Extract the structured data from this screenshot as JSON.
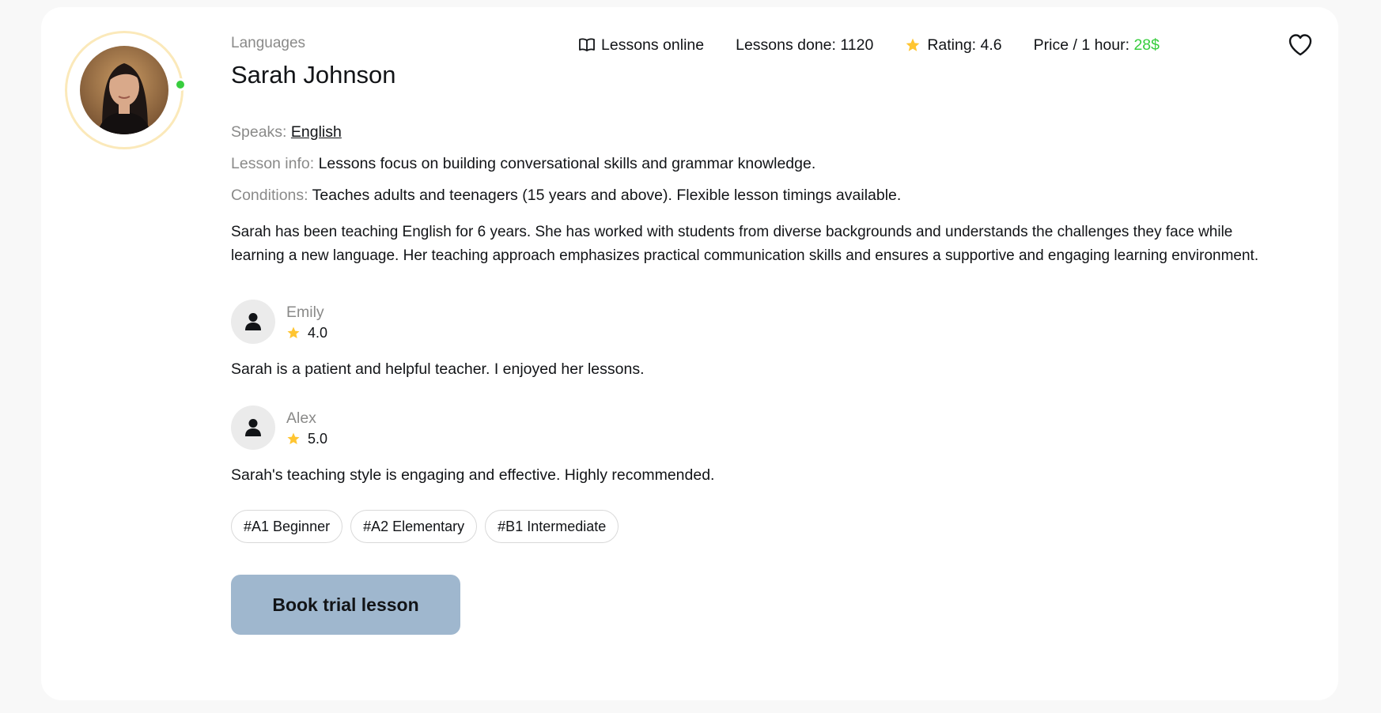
{
  "teacher": {
    "category": "Languages",
    "name": "Sarah Johnson",
    "online": true
  },
  "stats": {
    "lessons_online": "Lessons online",
    "lessons_done_label": "Lessons done: ",
    "lessons_done_value": "1120",
    "rating_label": "Rating: ",
    "rating_value": "4.6",
    "price_label": "Price / 1 hour: ",
    "price_value": "28$"
  },
  "info": {
    "speaks_label": "Speaks: ",
    "speaks_value": "English",
    "lesson_info_label": "Lesson info: ",
    "lesson_info_value": "Lessons focus on building conversational skills and grammar knowledge.",
    "conditions_label": "Conditions: ",
    "conditions_value": "Teaches adults and teenagers (15 years and above). Flexible lesson timings available."
  },
  "about": "Sarah has been teaching English for 6 years. She has worked with students from diverse backgrounds and understands the challenges they face while learning a new language. Her teaching approach emphasizes practical communication skills and ensures a supportive and engaging learning environment.",
  "reviews": [
    {
      "name": "Emily",
      "rating": "4.0",
      "text": "Sarah is a patient and helpful teacher. I enjoyed her lessons."
    },
    {
      "name": "Alex",
      "rating": "5.0",
      "text": "Sarah's teaching style is engaging and effective. Highly recommended."
    }
  ],
  "tags": [
    "#A1 Beginner",
    "#A2 Elementary",
    "#B1 Intermediate"
  ],
  "actions": {
    "book_label": "Book trial lesson"
  },
  "icons": {
    "book": "book-open-icon",
    "star": "star-icon",
    "heart": "heart-icon",
    "user": "user-icon"
  },
  "colors": {
    "accent_green": "#38cd3e",
    "star": "#ffc531",
    "button": "#9fb7ce",
    "avatar_ring": "#fbe9ba",
    "muted": "#8a8a89"
  }
}
